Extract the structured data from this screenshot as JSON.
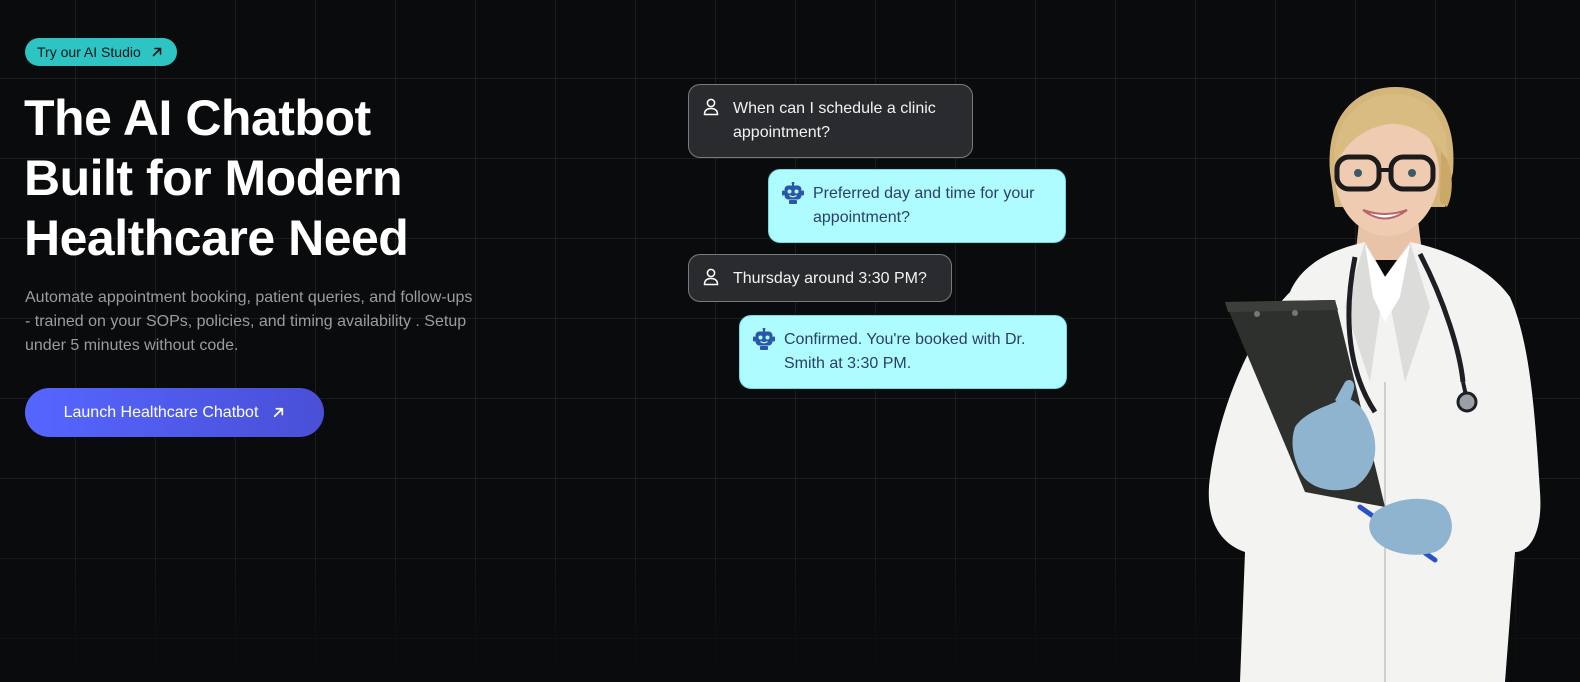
{
  "badge": {
    "label": "Try our AI Studio",
    "icon": "arrow-up-right-icon"
  },
  "hero": {
    "title_line1": "The AI Chatbot",
    "title_line2": "Built for Modern",
    "title_line3": "Healthcare Need",
    "subtitle": "Automate appointment booking, patient queries, and follow-ups - trained on your SOPs, policies, and timing availability . Setup under 5 minutes without code.",
    "cta_label": "Launch Healthcare Chatbot",
    "cta_icon": "arrow-up-right-icon"
  },
  "chat": {
    "messages": [
      {
        "role": "user",
        "icon": "user-icon",
        "text": "When can I schedule a clinic appointment?"
      },
      {
        "role": "bot",
        "icon": "robot-icon",
        "text": "Preferred day and time for your appointment?"
      },
      {
        "role": "user",
        "icon": "user-icon",
        "text": "Thursday around 3:30 PM?"
      },
      {
        "role": "bot",
        "icon": "robot-icon",
        "text": "Confirmed. You're booked with Dr. Smith at 3:30 PM."
      }
    ]
  },
  "colors": {
    "background": "#0a0b0d",
    "badge": "#2ec4c4",
    "cta": "#5566ff",
    "bot_bubble": "#aefcff",
    "user_bubble": "#2a2b2e"
  }
}
